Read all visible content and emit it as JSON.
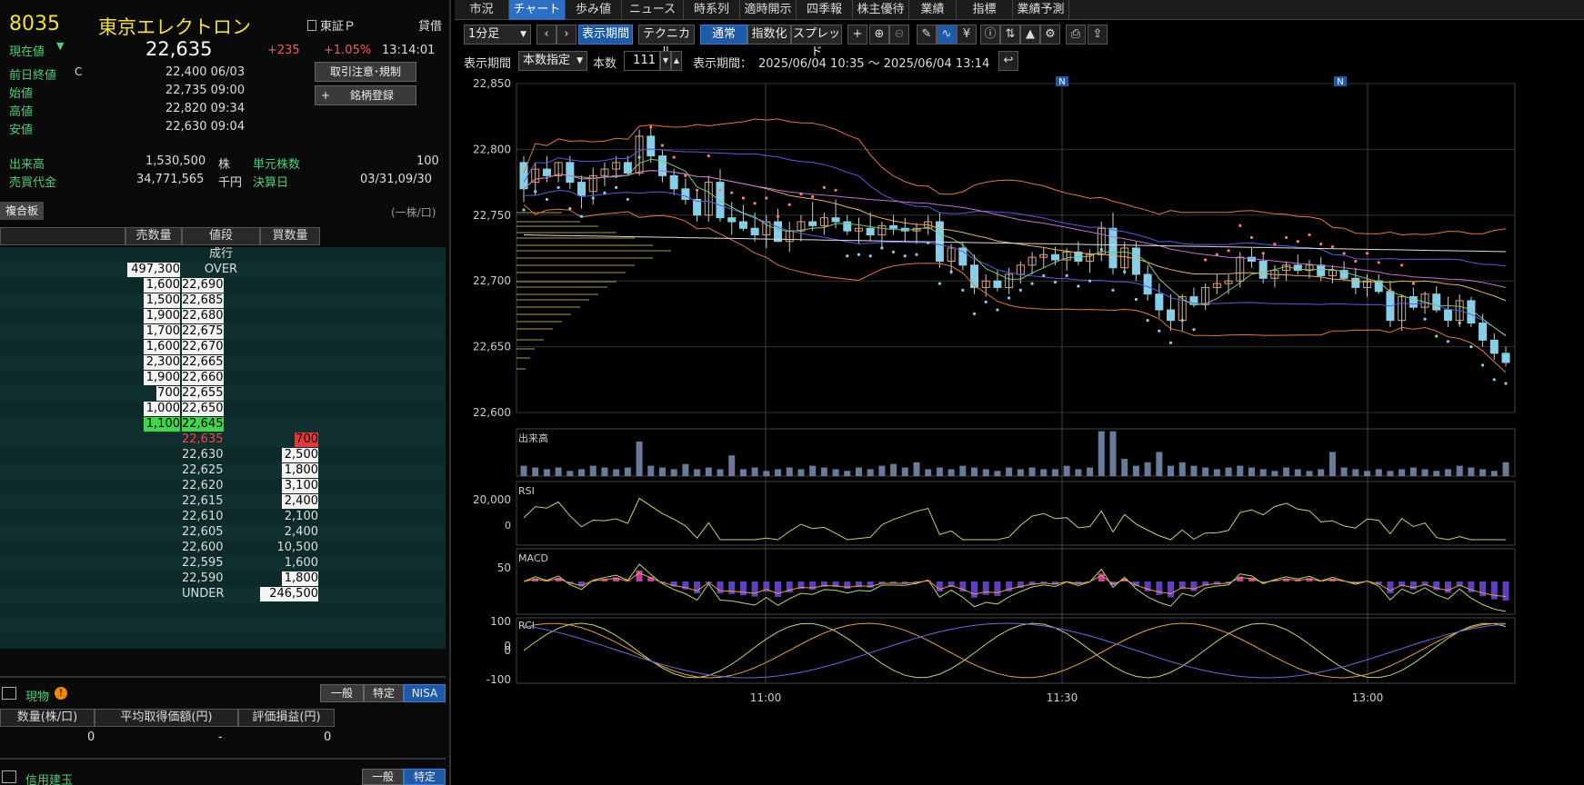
{
  "stock": {
    "code": "8035",
    "name": "東京エレクトロン",
    "market": "東証Ｐ",
    "lending": "貸借",
    "current_label": "現在値",
    "current_price": "22,635",
    "change": "+235",
    "change_pct": "+1.05%",
    "time": "13:14:01",
    "prev_close_label": "前日終値",
    "prev_close_flag": "C",
    "prev_close": "22,400 06/03",
    "open_label": "始値",
    "open": "22,735 09:00",
    "high_label": "高値",
    "high": "22,820 09:34",
    "low_label": "安値",
    "low": "22,630 09:04",
    "volume_label": "出来高",
    "volume": "1,530,500",
    "volume_unit": "株",
    "value_label": "売買代金",
    "value": "34,771,565",
    "value_unit": "千円",
    "unit_label": "単元株数",
    "unit": "100",
    "settle_label": "決算日",
    "settle": "03/31,09/30",
    "btn_notice": "取引注意･規制",
    "btn_register": "銘柄登録",
    "book_tab": "複合板",
    "book_unit": "(一株/口)"
  },
  "book": {
    "headers": [
      "売数量",
      "値段",
      "買数量"
    ],
    "market_order": "成行",
    "over_qty": "497,300",
    "over_label": "OVER",
    "asks": [
      {
        "qty": "1,600",
        "price": "22,690"
      },
      {
        "qty": "1,500",
        "price": "22,685"
      },
      {
        "qty": "1,900",
        "price": "22,680"
      },
      {
        "qty": "1,700",
        "price": "22,675"
      },
      {
        "qty": "1,600",
        "price": "22,670"
      },
      {
        "qty": "2,300",
        "price": "22,665"
      },
      {
        "qty": "1,900",
        "price": "22,660"
      },
      {
        "qty": "700",
        "price": "22,655"
      },
      {
        "qty": "1,000",
        "price": "22,650"
      },
      {
        "qty": "1,100",
        "price": "22,645"
      }
    ],
    "bids": [
      {
        "price": "22,635",
        "qty": "700"
      },
      {
        "price": "22,630",
        "qty": "2,500"
      },
      {
        "price": "22,625",
        "qty": "1,800"
      },
      {
        "price": "22,620",
        "qty": "3,100"
      },
      {
        "price": "22,615",
        "qty": "2,400"
      },
      {
        "price": "22,610",
        "qty": "2,100"
      },
      {
        "price": "22,605",
        "qty": "2,400"
      },
      {
        "price": "22,600",
        "qty": "10,500"
      },
      {
        "price": "22,595",
        "qty": "1,600"
      },
      {
        "price": "22,590",
        "qty": "1,800"
      }
    ],
    "under_label": "UNDER",
    "under_qty": "246,500"
  },
  "holdings": {
    "title": "現物",
    "tabs": [
      "一般",
      "特定",
      "NISA"
    ],
    "headers": [
      "数量(株/口)",
      "平均取得価額(円)",
      "評価損益(円)"
    ],
    "row": [
      "0",
      "-",
      "0"
    ],
    "margin_title": "信用建玉",
    "margin_tabs": [
      "一般",
      "特定"
    ]
  },
  "nav_tabs": [
    "市況",
    "チャート",
    "歩み値",
    "ニュース",
    "時系列",
    "適時開示",
    "四季報",
    "株主優待",
    "業績",
    "指標",
    "業績予測"
  ],
  "toolbar": {
    "interval": "1分足",
    "period_btn": "表示期間",
    "technical_btn": "テクニカル",
    "normal_btn": "通常",
    "index_btn": "指数化",
    "spread_btn": "スプレッド",
    "period_label": "表示期間",
    "period_mode": "本数指定",
    "count_label": "本数",
    "count": "111",
    "range_label": "表示期間：",
    "range": "2025/06/04 10:35 ～ 2025/06/04 13:14"
  },
  "chart_data": {
    "type": "candlestick",
    "y_ticks": [
      "22,850",
      "22,800",
      "22,750",
      "22,700",
      "22,650",
      "22,600"
    ],
    "ylim": [
      22600,
      22850
    ],
    "x_ticks": [
      "11:00",
      "11:30",
      "13:00"
    ],
    "news_marker": "N",
    "candles": [
      [
        22790,
        22795,
        22760,
        22770
      ],
      [
        22775,
        22790,
        22765,
        22785
      ],
      [
        22785,
        22795,
        22775,
        22780
      ],
      [
        22780,
        22790,
        22775,
        22790
      ],
      [
        22790,
        22795,
        22770,
        22775
      ],
      [
        22775,
        22780,
        22755,
        22765
      ],
      [
        22768,
        22786,
        22758,
        22780
      ],
      [
        22780,
        22790,
        22772,
        22785
      ],
      [
        22785,
        22795,
        22778,
        22790
      ],
      [
        22790,
        22795,
        22780,
        22782
      ],
      [
        22782,
        22815,
        22780,
        22810
      ],
      [
        22810,
        22818,
        22790,
        22795
      ],
      [
        22795,
        22800,
        22775,
        22780
      ],
      [
        22780,
        22785,
        22765,
        22770
      ],
      [
        22770,
        22778,
        22758,
        22762
      ],
      [
        22762,
        22768,
        22745,
        22750
      ],
      [
        22750,
        22780,
        22745,
        22775
      ],
      [
        22775,
        22785,
        22745,
        22748
      ],
      [
        22748,
        22760,
        22735,
        22745
      ],
      [
        22745,
        22758,
        22738,
        22740
      ],
      [
        22740,
        22752,
        22730,
        22735
      ],
      [
        22735,
        22750,
        22725,
        22745
      ],
      [
        22745,
        22755,
        22735,
        22730
      ],
      [
        22730,
        22745,
        22722,
        22738
      ],
      [
        22738,
        22750,
        22730,
        22745
      ],
      [
        22745,
        22760,
        22738,
        22742
      ],
      [
        22742,
        22752,
        22735,
        22748
      ],
      [
        22748,
        22762,
        22740,
        22745
      ],
      [
        22745,
        22750,
        22735,
        22738
      ],
      [
        22738,
        22748,
        22728,
        22740
      ],
      [
        22740,
        22752,
        22730,
        22735
      ],
      [
        22735,
        22745,
        22725,
        22742
      ],
      [
        22742,
        22750,
        22735,
        22740
      ],
      [
        22740,
        22748,
        22730,
        22738
      ],
      [
        22738,
        22744,
        22728,
        22740
      ],
      [
        22740,
        22750,
        22735,
        22745
      ],
      [
        22745,
        22752,
        22710,
        22715
      ],
      [
        22715,
        22728,
        22705,
        22725
      ],
      [
        22725,
        22730,
        22708,
        22712
      ],
      [
        22712,
        22720,
        22690,
        22695
      ],
      [
        22695,
        22705,
        22688,
        22700
      ],
      [
        22700,
        22708,
        22692,
        22695
      ],
      [
        22695,
        22710,
        22690,
        22705
      ],
      [
        22705,
        22715,
        22698,
        22712
      ],
      [
        22712,
        22722,
        22705,
        22718
      ],
      [
        22718,
        22725,
        22710,
        22720
      ],
      [
        22720,
        22726,
        22712,
        22716
      ],
      [
        22716,
        22725,
        22708,
        22722
      ],
      [
        22722,
        22730,
        22712,
        22715
      ],
      [
        22715,
        22724,
        22706,
        22720
      ],
      [
        22720,
        22745,
        22715,
        22740
      ],
      [
        22740,
        22752,
        22705,
        22710
      ],
      [
        22710,
        22730,
        22705,
        22725
      ],
      [
        22725,
        22730,
        22700,
        22705
      ],
      [
        22705,
        22712,
        22685,
        22690
      ],
      [
        22690,
        22698,
        22672,
        22678
      ],
      [
        22678,
        22690,
        22662,
        22670
      ],
      [
        22670,
        22690,
        22662,
        22688
      ],
      [
        22688,
        22695,
        22680,
        22682
      ],
      [
        22682,
        22698,
        22678,
        22695
      ],
      [
        22695,
        22705,
        22690,
        22698
      ],
      [
        22698,
        22705,
        22690,
        22700
      ],
      [
        22700,
        22722,
        22695,
        22718
      ],
      [
        22718,
        22725,
        22710,
        22715
      ],
      [
        22715,
        22720,
        22698,
        22702
      ],
      [
        22702,
        22712,
        22695,
        22708
      ],
      [
        22708,
        22715,
        22700,
        22712
      ],
      [
        22712,
        22720,
        22705,
        22708
      ],
      [
        22708,
        22716,
        22702,
        22712
      ],
      [
        22712,
        22718,
        22700,
        22704
      ],
      [
        22704,
        22712,
        22698,
        22708
      ],
      [
        22708,
        22715,
        22700,
        22702
      ],
      [
        22702,
        22710,
        22690,
        22695
      ],
      [
        22695,
        22705,
        22688,
        22700
      ],
      [
        22700,
        22705,
        22690,
        22692
      ],
      [
        22692,
        22700,
        22665,
        22670
      ],
      [
        22670,
        22690,
        22662,
        22688
      ],
      [
        22688,
        22695,
        22678,
        22680
      ],
      [
        22680,
        22692,
        22675,
        22690
      ],
      [
        22690,
        22696,
        22676,
        22678
      ],
      [
        22678,
        22688,
        22665,
        22670
      ],
      [
        22670,
        22690,
        22665,
        22685
      ],
      [
        22685,
        22688,
        22665,
        22668
      ],
      [
        22668,
        22675,
        22650,
        22655
      ],
      [
        22655,
        22660,
        22640,
        22645
      ],
      [
        22645,
        22650,
        22635,
        22638
      ]
    ],
    "sub_panels": [
      {
        "name": "出来高",
        "tick": "20,000",
        "zero": "0"
      },
      {
        "name": "RSI",
        "tick": "50"
      },
      {
        "name": "MACD",
        "tick": "0"
      },
      {
        "name": "RCI",
        "ticks": [
          "100",
          "0",
          "-100"
        ]
      }
    ],
    "volume": [
      6,
      5,
      4,
      5,
      3,
      4,
      6,
      5,
      4,
      5,
      20,
      6,
      5,
      4,
      7,
      4,
      5,
      4,
      12,
      4,
      5,
      3,
      4,
      5,
      4,
      6,
      5,
      4,
      3,
      5,
      4,
      6,
      7,
      5,
      8,
      4,
      5,
      4,
      6,
      5,
      4,
      3,
      5,
      4,
      5,
      4,
      4,
      6,
      4,
      5,
      26,
      26,
      10,
      6,
      8,
      14,
      6,
      8,
      6,
      5,
      4,
      5,
      6,
      5,
      4,
      3,
      5,
      4,
      3,
      4,
      14,
      5,
      4,
      3,
      4,
      3,
      4,
      5,
      4,
      3,
      4,
      6,
      5,
      4,
      3,
      8,
      7,
      5,
      4,
      4,
      3,
      16,
      5,
      4,
      6,
      5,
      4,
      3,
      4,
      5,
      6,
      4,
      5,
      3,
      4,
      5,
      4,
      4,
      3,
      12,
      4
    ],
    "colors": {
      "up": "#87cfe8",
      "down": "#e8a070",
      "wick": "#cccccc"
    }
  }
}
